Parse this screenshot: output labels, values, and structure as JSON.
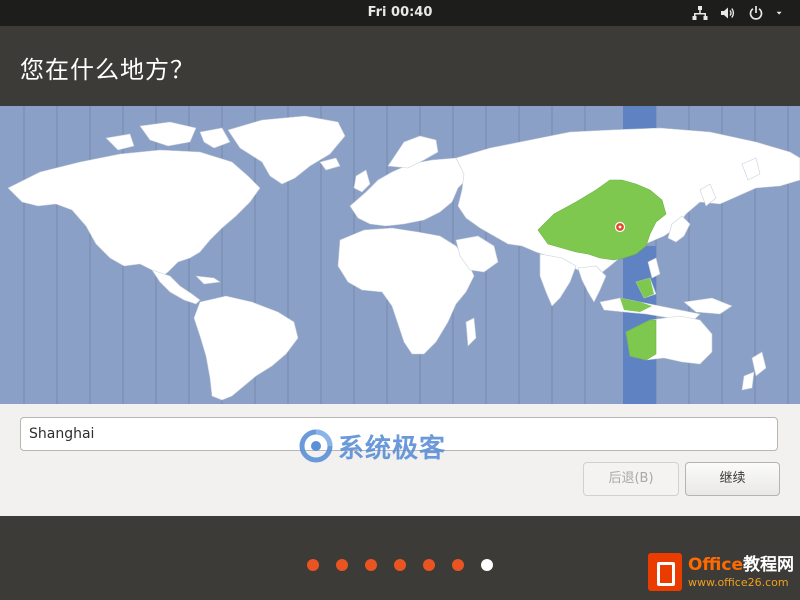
{
  "topbar": {
    "clock": "Fri 00:40",
    "icons": [
      "network-icon",
      "volume-icon",
      "power-icon",
      "menu-arrow-icon"
    ]
  },
  "installer": {
    "title": "您在什么地方？",
    "location_value": "Shanghai",
    "back_label": "后退(B)",
    "next_label": "继续",
    "back_enabled": false
  },
  "map": {
    "ocean_color": "#8ba0c6",
    "land_color": "#ffffff",
    "selected_region_color": "#7ec850",
    "selected_timezone_band_color": "#5f82c2",
    "marker_color": "#e04a2a",
    "selected_city": "Shanghai"
  },
  "progress": {
    "total_steps": 7,
    "current_step": 7,
    "active_color": "#e95420"
  },
  "watermark": {
    "text": "系统极客"
  },
  "badge": {
    "brand_prefix": "Office",
    "brand_suffix": "教程网",
    "url": "www.office26.com"
  }
}
